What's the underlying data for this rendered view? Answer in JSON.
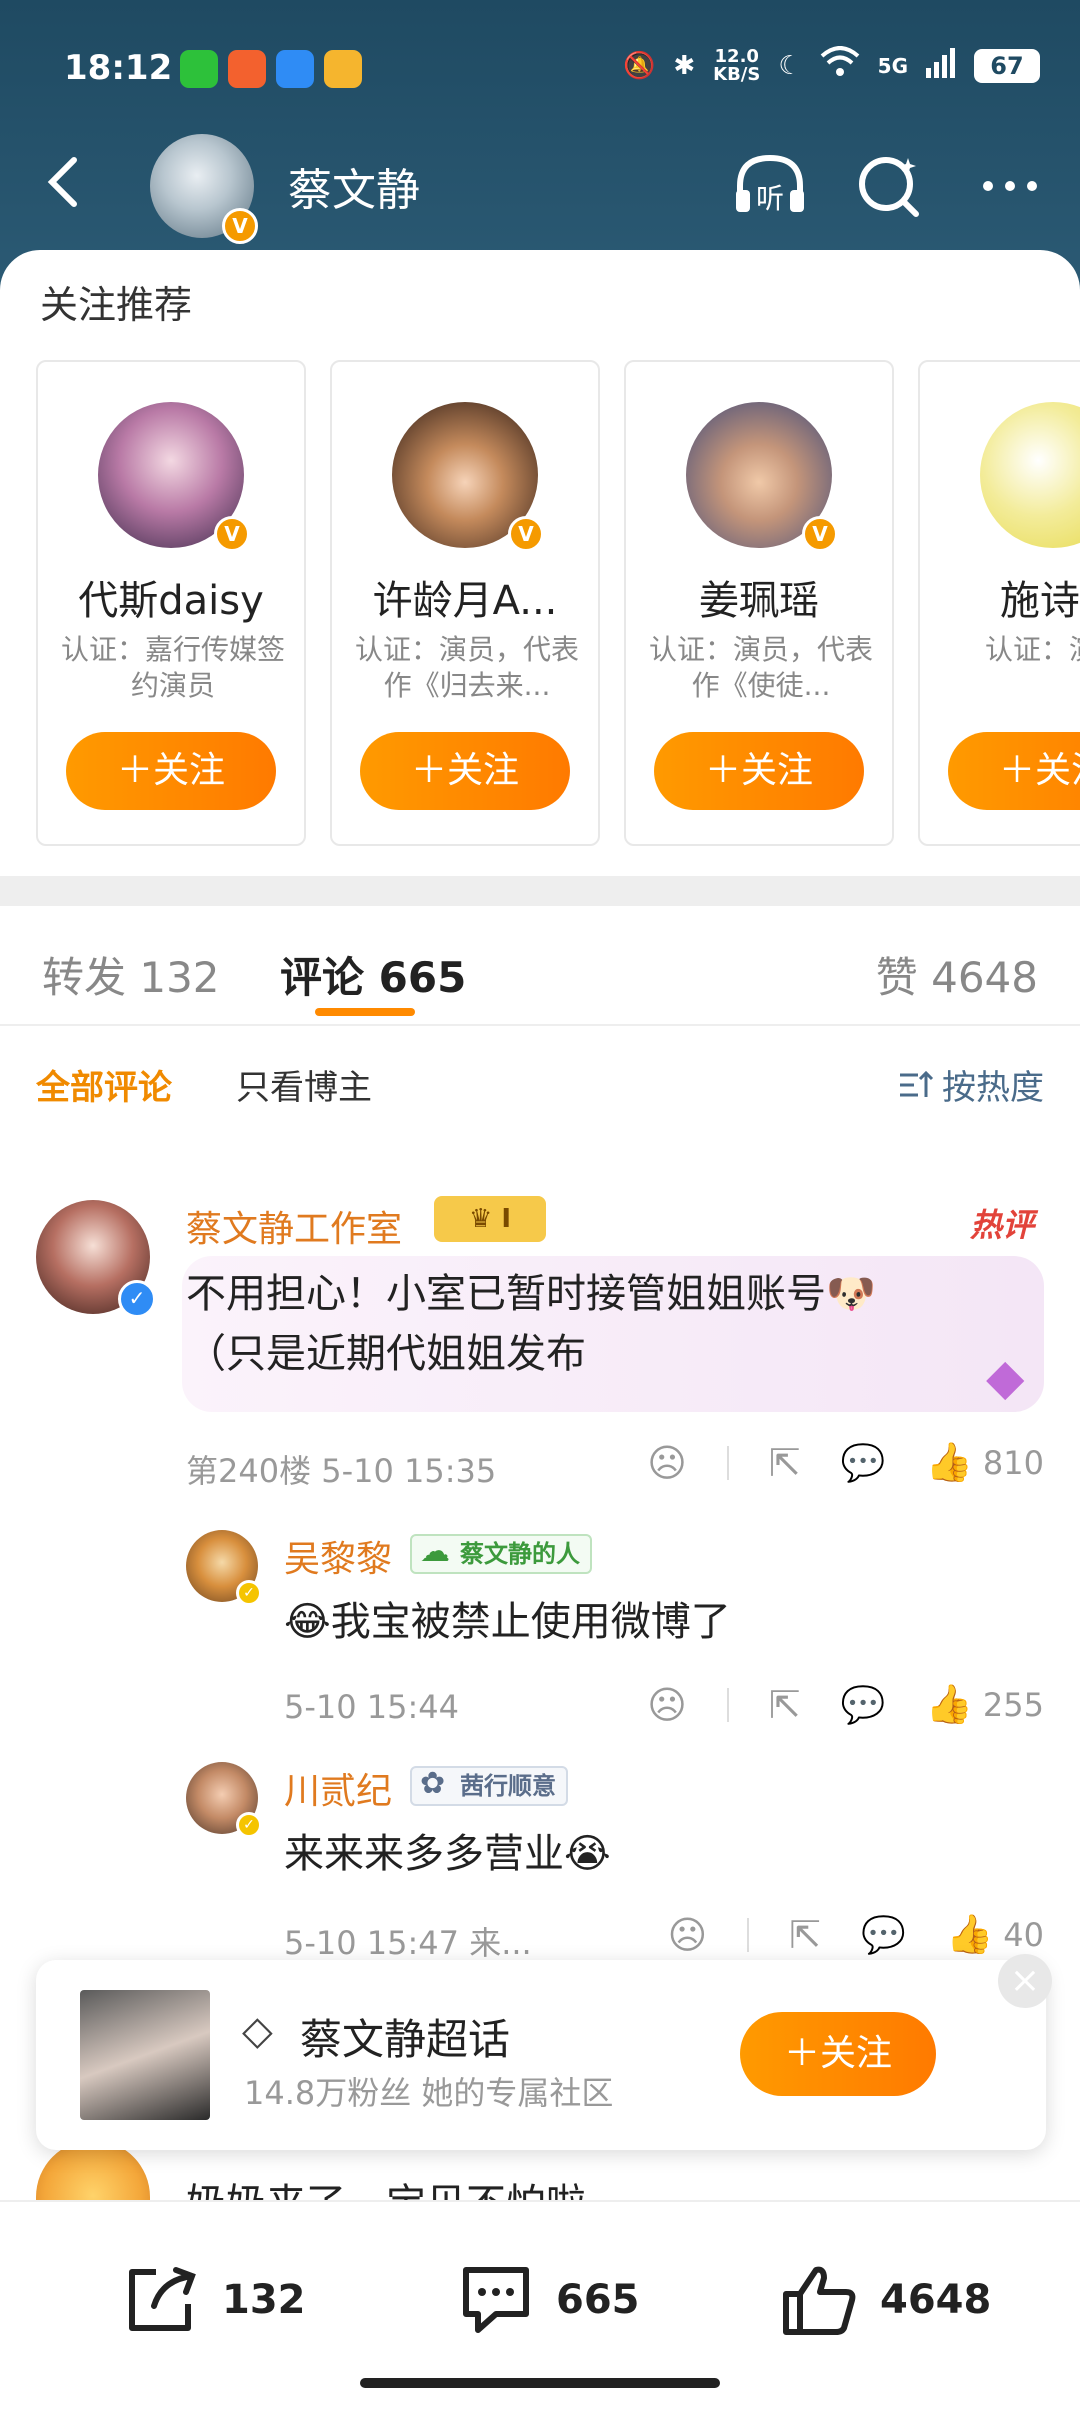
{
  "status": {
    "time": "18:12",
    "net_speed": "12.0\nKB/S",
    "signal": "5G",
    "battery": "67"
  },
  "nav": {
    "title": "蔡文静",
    "listen_label": "听"
  },
  "recommend": {
    "title": "关注推荐",
    "follow_label": "＋关注",
    "cards": [
      {
        "name": "代斯daisy",
        "desc": "认证：嘉行传媒签约演员"
      },
      {
        "name": "许龄月A...",
        "desc": "认证：演员，代表作《归去来..."
      },
      {
        "name": "姜珮瑶",
        "desc": "认证：演员，代表作《使徒..."
      },
      {
        "name": "施诗K",
        "desc": "认证：演员"
      }
    ]
  },
  "tabs": {
    "repost": "转发 132",
    "comment": "评论 665",
    "like": "赞 4648"
  },
  "filter": {
    "all": "全部评论",
    "host_only": "只看博主",
    "sort": "按热度"
  },
  "comments": {
    "main": {
      "name": "蔡文静工作室",
      "level": "I",
      "hot_label": "热评",
      "text_line1": "不用担心！小室已暂时接管姐姐账号",
      "text_line2": "（只是近期代姐姐发布",
      "meta": "第240楼  5-10 15:35",
      "likes": "810"
    },
    "reply1": {
      "name": "吴黎黎",
      "tag": "蔡文静的人",
      "text": "😂我宝被禁止使用微博了",
      "meta": "5-10 15:44",
      "likes": "255"
    },
    "reply2": {
      "name": "川贰纪",
      "tag": "茜行顺意",
      "text": "来来来多多营业😭",
      "meta": "5-10 15:47  来...",
      "likes": "40"
    },
    "next_partial": "奶奶来了，宝贝不怕啦"
  },
  "banner": {
    "title": "蔡文静超话",
    "subtitle": "14.8万粉丝 她的专属社区",
    "button": "＋关注",
    "close": "×"
  },
  "bottom": {
    "repost": "132",
    "comment": "665",
    "like": "4648"
  },
  "colors": {
    "header_bg": "#1f4a62",
    "accent_orange": "#ff8a00",
    "name_orange": "#e07a1f",
    "hot_red": "#e2433a"
  }
}
